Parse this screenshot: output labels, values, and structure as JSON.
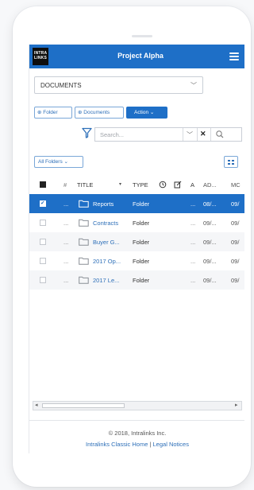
{
  "header": {
    "logo_line1": "INTRA",
    "logo_line2": "LINKS",
    "title": "Project Alpha"
  },
  "section_select": {
    "value": "DOCUMENTS"
  },
  "toolbar": {
    "folder_label": "Folder",
    "documents_label": "Documents",
    "action_label": "Action"
  },
  "search": {
    "placeholder": "Search..."
  },
  "folders_select": {
    "value": "All Folders"
  },
  "table": {
    "columns": {
      "num": "#",
      "title": "TITLE",
      "type": "TYPE",
      "a": "A",
      "added": "AD...",
      "modified": "MC"
    },
    "rows": [
      {
        "title": "Reports",
        "type": "Folder",
        "dots": "...",
        "a": "...",
        "added": "08/...",
        "modified": "09/",
        "selected": true
      },
      {
        "title": "Contracts",
        "type": "Folder",
        "dots": "...",
        "a": "...",
        "added": "09/...",
        "modified": "09/",
        "selected": false
      },
      {
        "title": "Buyer G...",
        "type": "Folder",
        "dots": "...",
        "a": "...",
        "added": "09/...",
        "modified": "09/",
        "selected": false
      },
      {
        "title": "2017 Op...",
        "type": "Folder",
        "dots": "...",
        "a": "...",
        "added": "09/...",
        "modified": "09/",
        "selected": false
      },
      {
        "title": "2017 Le...",
        "type": "Folder",
        "dots": "...",
        "a": "...",
        "added": "09/...",
        "modified": "09/",
        "selected": false
      }
    ]
  },
  "footer": {
    "copyright": "© 2018, Intralinks Inc.",
    "link_home": "Intralinks Classic Home",
    "separator": "|",
    "link_legal": "Legal Notices"
  },
  "colors": {
    "brand_blue": "#1e6fc7",
    "link_blue": "#2d6fb8"
  }
}
